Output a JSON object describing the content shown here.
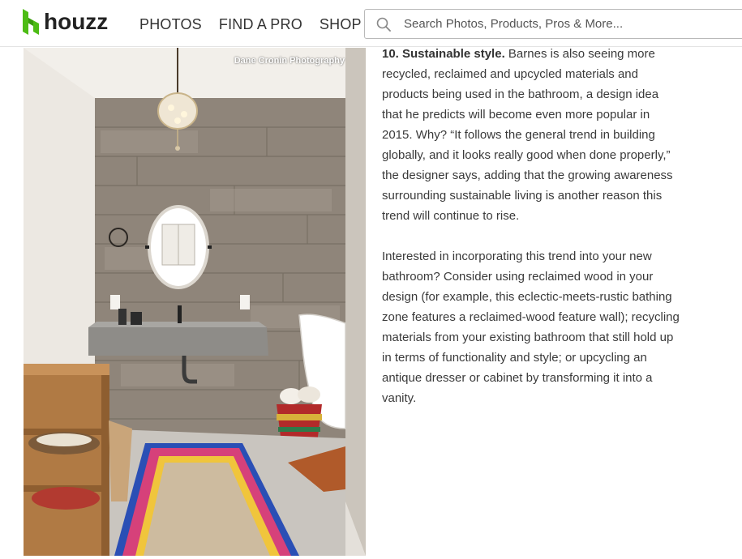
{
  "brand": {
    "name": "houzz"
  },
  "nav": {
    "items": [
      "PHOTOS",
      "FIND A PRO",
      "SHOP"
    ]
  },
  "search": {
    "placeholder": "Search Photos, Products, Pros & More..."
  },
  "photo": {
    "credit": "Dane Cronin Photography"
  },
  "article": {
    "heading": "10. Sustainable style.",
    "paragraph1": " Barnes is also seeing more recycled, reclaimed and upcycled materials and products being used in the bathroom, a design idea that he predicts will become even more popular in 2015. Why? “It follows the general trend in building globally, and it looks really good when done properly,” the designer says, adding that the growing awareness surrounding sustainable living is another reason this trend will continue to rise.",
    "paragraph2": "Interested in incorporating this trend into your new bathroom? Consider using reclaimed wood in your design (for example, this eclectic-meets-rustic bathing zone features a reclaimed-wood feature wall); recycling materials from your existing bathroom that still hold up in terms of functionality and style; or upcycling an antique dresser or cabinet by transforming it into a vanity."
  },
  "colors": {
    "brand_green": "#4DBC15",
    "text": "#3a3a3a"
  }
}
